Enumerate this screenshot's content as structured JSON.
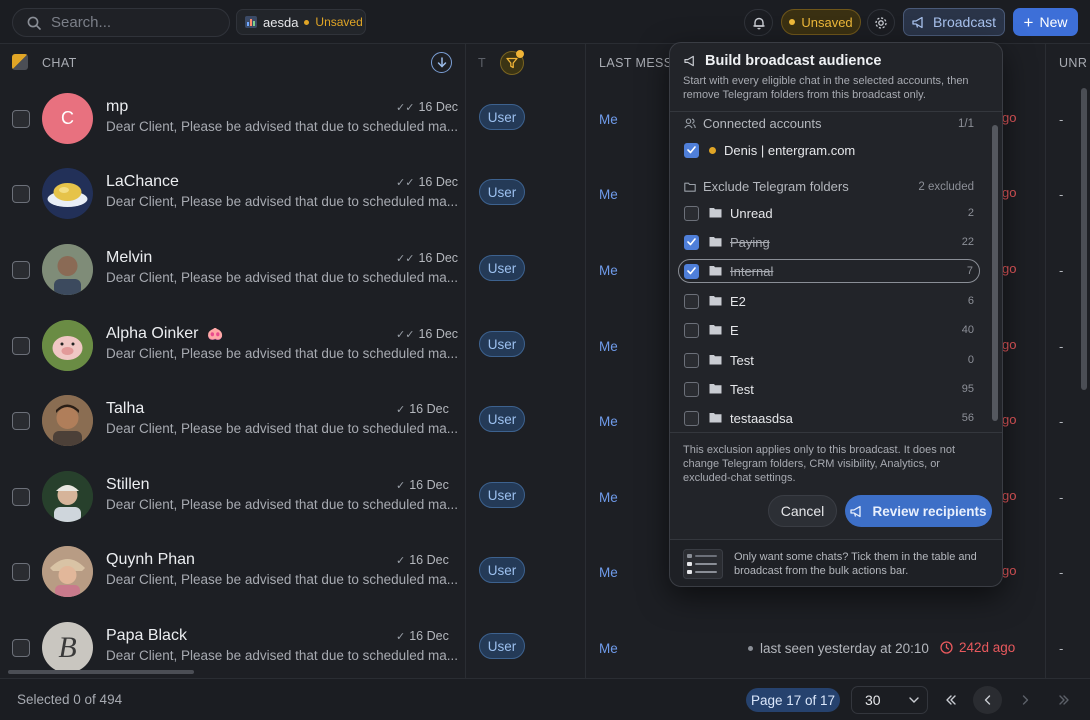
{
  "topbar": {
    "search_placeholder": "Search...",
    "view_name": "aesda",
    "view_status": "Unsaved",
    "unsaved_label": "Unsaved",
    "broadcast_label": "Broadcast",
    "new_label": "New"
  },
  "table": {
    "headers": {
      "chat": "CHAT",
      "type": "T",
      "last": "LAST MESSA",
      "unread": "UNR"
    },
    "rows": [
      {
        "name": "mp",
        "initial": "C",
        "date": "16 Dec",
        "preview": "Dear Client, Please be advised that due to scheduled ma...",
        "type": "User",
        "last": "Me",
        "ago": "go",
        "unread": "-"
      },
      {
        "name": "LaChance",
        "initial": "",
        "date": "16 Dec",
        "preview": "Dear Client, Please be advised that due to scheduled ma...",
        "type": "User",
        "last": "Me",
        "ago": "go",
        "unread": "-"
      },
      {
        "name": "Melvin",
        "initial": "",
        "date": "16 Dec",
        "preview": "Dear Client, Please be advised that due to scheduled ma...",
        "type": "User",
        "last": "Me",
        "ago": "go",
        "unread": "-"
      },
      {
        "name": "Alpha Oinker",
        "initial": "",
        "date": "16 Dec",
        "preview": "Dear Client, Please be advised that due to scheduled ma...",
        "type": "User",
        "last": "Me",
        "ago": "go",
        "unread": "-"
      },
      {
        "name": "Talha",
        "initial": "",
        "date": "16 Dec",
        "preview": "Dear Client, Please be advised that due to scheduled ma...",
        "type": "User",
        "last": "Me",
        "ago": "go",
        "unread": "-"
      },
      {
        "name": "Stillen",
        "initial": "",
        "date": "16 Dec",
        "preview": "Dear Client, Please be advised that due to scheduled ma...",
        "type": "User",
        "last": "Me",
        "ago": "go",
        "unread": "-"
      },
      {
        "name": "Quynh Phan",
        "initial": "",
        "date": "16 Dec",
        "preview": "Dear Client, Please be advised that due to scheduled ma...",
        "type": "User",
        "last": "Me",
        "ago": "go",
        "unread": "-"
      },
      {
        "name": "Papa Black",
        "initial": "B",
        "date": "16 Dec",
        "preview": "Dear Client, Please be advised that due to scheduled ma...",
        "type": "User",
        "last": "Me",
        "lastseen": "last seen yesterday at 20:10",
        "ago": "242d ago",
        "unread": "-"
      }
    ]
  },
  "footer": {
    "selected": "Selected 0 of 494",
    "page": "Page 17 of 17",
    "page_size": "30"
  },
  "popover": {
    "title": "Build broadcast audience",
    "description": "Start with every eligible chat in the selected accounts, then remove Telegram folders from this broadcast only.",
    "accounts_heading": "Connected accounts",
    "accounts_count": "1/1",
    "account_name": "Denis | entergram.com",
    "folders_heading": "Exclude Telegram folders",
    "folders_excluded": "2 excluded",
    "folders": [
      {
        "label": "Unread",
        "count": "2",
        "excluded": false
      },
      {
        "label": "Paying",
        "count": "22",
        "excluded": true
      },
      {
        "label": "Internal",
        "count": "7",
        "excluded": true
      },
      {
        "label": "E2",
        "count": "6",
        "excluded": false
      },
      {
        "label": "E",
        "count": "40",
        "excluded": false
      },
      {
        "label": "Test",
        "count": "0",
        "excluded": false
      },
      {
        "label": "Test",
        "count": "95",
        "excluded": false
      },
      {
        "label": "testaasdsa",
        "count": "56",
        "excluded": false
      }
    ],
    "note": "This exclusion applies only to this broadcast. It does not change Telegram folders, CRM visibility, Analytics, or excluded-chat settings.",
    "cancel_label": "Cancel",
    "review_label": "Review recipients",
    "tip": "Only want some chats? Tick them in the table and broadcast from the bulk actions bar."
  },
  "colors": {
    "accent": "#3d6fd8",
    "warning": "#e0a526",
    "danger": "#e8595d",
    "badge": "#243a57"
  }
}
